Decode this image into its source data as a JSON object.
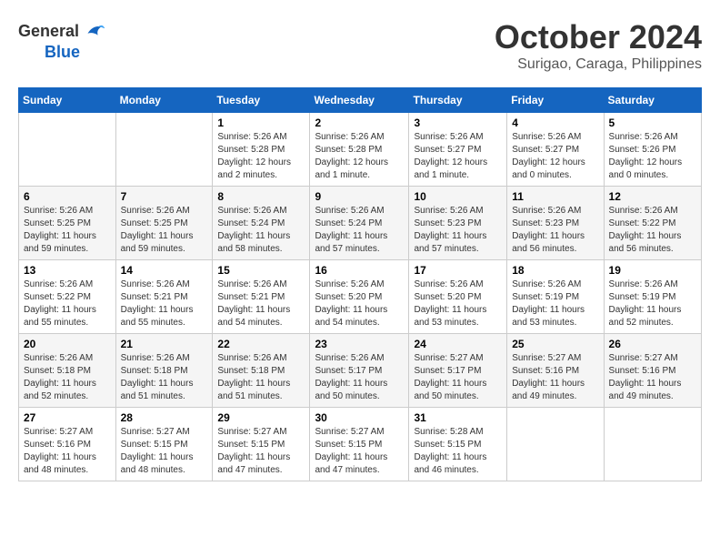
{
  "header": {
    "logo": {
      "general": "General",
      "blue": "Blue"
    },
    "title": "October 2024",
    "location": "Surigao, Caraga, Philippines"
  },
  "calendar": {
    "days_of_week": [
      "Sunday",
      "Monday",
      "Tuesday",
      "Wednesday",
      "Thursday",
      "Friday",
      "Saturday"
    ],
    "weeks": [
      [
        {
          "day": "",
          "sunrise": "",
          "sunset": "",
          "daylight": ""
        },
        {
          "day": "",
          "sunrise": "",
          "sunset": "",
          "daylight": ""
        },
        {
          "day": "1",
          "sunrise": "Sunrise: 5:26 AM",
          "sunset": "Sunset: 5:28 PM",
          "daylight": "Daylight: 12 hours and 2 minutes."
        },
        {
          "day": "2",
          "sunrise": "Sunrise: 5:26 AM",
          "sunset": "Sunset: 5:28 PM",
          "daylight": "Daylight: 12 hours and 1 minute."
        },
        {
          "day": "3",
          "sunrise": "Sunrise: 5:26 AM",
          "sunset": "Sunset: 5:27 PM",
          "daylight": "Daylight: 12 hours and 1 minute."
        },
        {
          "day": "4",
          "sunrise": "Sunrise: 5:26 AM",
          "sunset": "Sunset: 5:27 PM",
          "daylight": "Daylight: 12 hours and 0 minutes."
        },
        {
          "day": "5",
          "sunrise": "Sunrise: 5:26 AM",
          "sunset": "Sunset: 5:26 PM",
          "daylight": "Daylight: 12 hours and 0 minutes."
        }
      ],
      [
        {
          "day": "6",
          "sunrise": "Sunrise: 5:26 AM",
          "sunset": "Sunset: 5:25 PM",
          "daylight": "Daylight: 11 hours and 59 minutes."
        },
        {
          "day": "7",
          "sunrise": "Sunrise: 5:26 AM",
          "sunset": "Sunset: 5:25 PM",
          "daylight": "Daylight: 11 hours and 59 minutes."
        },
        {
          "day": "8",
          "sunrise": "Sunrise: 5:26 AM",
          "sunset": "Sunset: 5:24 PM",
          "daylight": "Daylight: 11 hours and 58 minutes."
        },
        {
          "day": "9",
          "sunrise": "Sunrise: 5:26 AM",
          "sunset": "Sunset: 5:24 PM",
          "daylight": "Daylight: 11 hours and 57 minutes."
        },
        {
          "day": "10",
          "sunrise": "Sunrise: 5:26 AM",
          "sunset": "Sunset: 5:23 PM",
          "daylight": "Daylight: 11 hours and 57 minutes."
        },
        {
          "day": "11",
          "sunrise": "Sunrise: 5:26 AM",
          "sunset": "Sunset: 5:23 PM",
          "daylight": "Daylight: 11 hours and 56 minutes."
        },
        {
          "day": "12",
          "sunrise": "Sunrise: 5:26 AM",
          "sunset": "Sunset: 5:22 PM",
          "daylight": "Daylight: 11 hours and 56 minutes."
        }
      ],
      [
        {
          "day": "13",
          "sunrise": "Sunrise: 5:26 AM",
          "sunset": "Sunset: 5:22 PM",
          "daylight": "Daylight: 11 hours and 55 minutes."
        },
        {
          "day": "14",
          "sunrise": "Sunrise: 5:26 AM",
          "sunset": "Sunset: 5:21 PM",
          "daylight": "Daylight: 11 hours and 55 minutes."
        },
        {
          "day": "15",
          "sunrise": "Sunrise: 5:26 AM",
          "sunset": "Sunset: 5:21 PM",
          "daylight": "Daylight: 11 hours and 54 minutes."
        },
        {
          "day": "16",
          "sunrise": "Sunrise: 5:26 AM",
          "sunset": "Sunset: 5:20 PM",
          "daylight": "Daylight: 11 hours and 54 minutes."
        },
        {
          "day": "17",
          "sunrise": "Sunrise: 5:26 AM",
          "sunset": "Sunset: 5:20 PM",
          "daylight": "Daylight: 11 hours and 53 minutes."
        },
        {
          "day": "18",
          "sunrise": "Sunrise: 5:26 AM",
          "sunset": "Sunset: 5:19 PM",
          "daylight": "Daylight: 11 hours and 53 minutes."
        },
        {
          "day": "19",
          "sunrise": "Sunrise: 5:26 AM",
          "sunset": "Sunset: 5:19 PM",
          "daylight": "Daylight: 11 hours and 52 minutes."
        }
      ],
      [
        {
          "day": "20",
          "sunrise": "Sunrise: 5:26 AM",
          "sunset": "Sunset: 5:18 PM",
          "daylight": "Daylight: 11 hours and 52 minutes."
        },
        {
          "day": "21",
          "sunrise": "Sunrise: 5:26 AM",
          "sunset": "Sunset: 5:18 PM",
          "daylight": "Daylight: 11 hours and 51 minutes."
        },
        {
          "day": "22",
          "sunrise": "Sunrise: 5:26 AM",
          "sunset": "Sunset: 5:18 PM",
          "daylight": "Daylight: 11 hours and 51 minutes."
        },
        {
          "day": "23",
          "sunrise": "Sunrise: 5:26 AM",
          "sunset": "Sunset: 5:17 PM",
          "daylight": "Daylight: 11 hours and 50 minutes."
        },
        {
          "day": "24",
          "sunrise": "Sunrise: 5:27 AM",
          "sunset": "Sunset: 5:17 PM",
          "daylight": "Daylight: 11 hours and 50 minutes."
        },
        {
          "day": "25",
          "sunrise": "Sunrise: 5:27 AM",
          "sunset": "Sunset: 5:16 PM",
          "daylight": "Daylight: 11 hours and 49 minutes."
        },
        {
          "day": "26",
          "sunrise": "Sunrise: 5:27 AM",
          "sunset": "Sunset: 5:16 PM",
          "daylight": "Daylight: 11 hours and 49 minutes."
        }
      ],
      [
        {
          "day": "27",
          "sunrise": "Sunrise: 5:27 AM",
          "sunset": "Sunset: 5:16 PM",
          "daylight": "Daylight: 11 hours and 48 minutes."
        },
        {
          "day": "28",
          "sunrise": "Sunrise: 5:27 AM",
          "sunset": "Sunset: 5:15 PM",
          "daylight": "Daylight: 11 hours and 48 minutes."
        },
        {
          "day": "29",
          "sunrise": "Sunrise: 5:27 AM",
          "sunset": "Sunset: 5:15 PM",
          "daylight": "Daylight: 11 hours and 47 minutes."
        },
        {
          "day": "30",
          "sunrise": "Sunrise: 5:27 AM",
          "sunset": "Sunset: 5:15 PM",
          "daylight": "Daylight: 11 hours and 47 minutes."
        },
        {
          "day": "31",
          "sunrise": "Sunrise: 5:28 AM",
          "sunset": "Sunset: 5:15 PM",
          "daylight": "Daylight: 11 hours and 46 minutes."
        },
        {
          "day": "",
          "sunrise": "",
          "sunset": "",
          "daylight": ""
        },
        {
          "day": "",
          "sunrise": "",
          "sunset": "",
          "daylight": ""
        }
      ]
    ]
  }
}
